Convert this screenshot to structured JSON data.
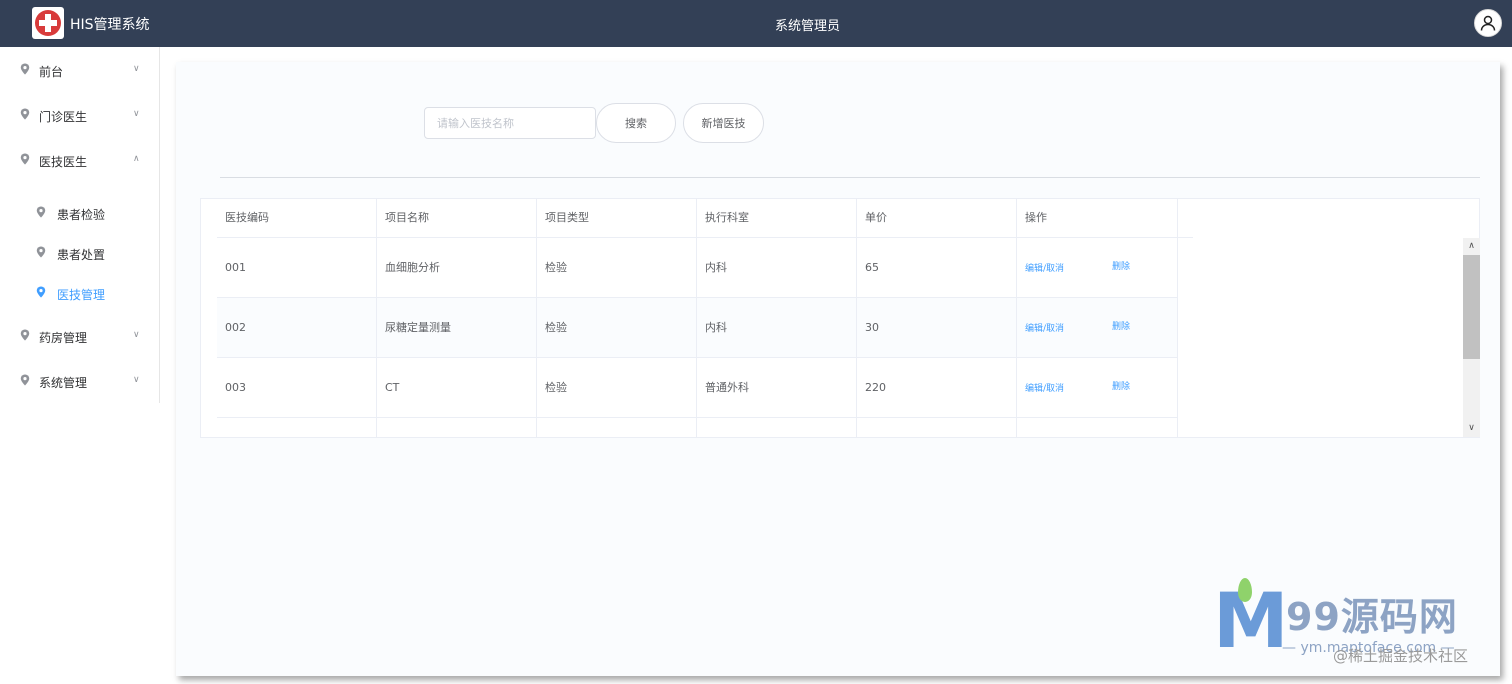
{
  "header": {
    "app_title": "HIS管理系统",
    "user_label": "系统管理员"
  },
  "sidebar": {
    "items": [
      {
        "label": "前台"
      },
      {
        "label": "门诊医生"
      },
      {
        "label": "医技医生"
      },
      {
        "label": "药房管理"
      },
      {
        "label": "系统管理"
      }
    ],
    "sub_items": [
      {
        "label": "患者检验"
      },
      {
        "label": "患者处置"
      },
      {
        "label": "医技管理"
      }
    ],
    "active_sub_color": "#409eff"
  },
  "toolbar": {
    "search_placeholder": "请输入医技名称",
    "search_label": "搜索",
    "add_label": "新增医技"
  },
  "table": {
    "columns": [
      "医技编码",
      "项目名称",
      "项目类型",
      "执行科室",
      "单价",
      "操作"
    ],
    "rows": [
      {
        "code": "001",
        "name": "血细胞分析",
        "type": "检验",
        "dept": "内科",
        "price": "65"
      },
      {
        "code": "002",
        "name": "尿糖定量测量",
        "type": "检验",
        "dept": "内科",
        "price": "30"
      },
      {
        "code": "003",
        "name": "CT",
        "type": "检验",
        "dept": "普通外科",
        "price": "220"
      }
    ],
    "action_edit": "编辑",
    "action_cancel": "/取消",
    "action_delete": "删除"
  },
  "watermark": {
    "title": "99源码网",
    "subtitle": "— ym.maptoface.com —",
    "subtitle2": "@稀土掘金技术社区"
  }
}
